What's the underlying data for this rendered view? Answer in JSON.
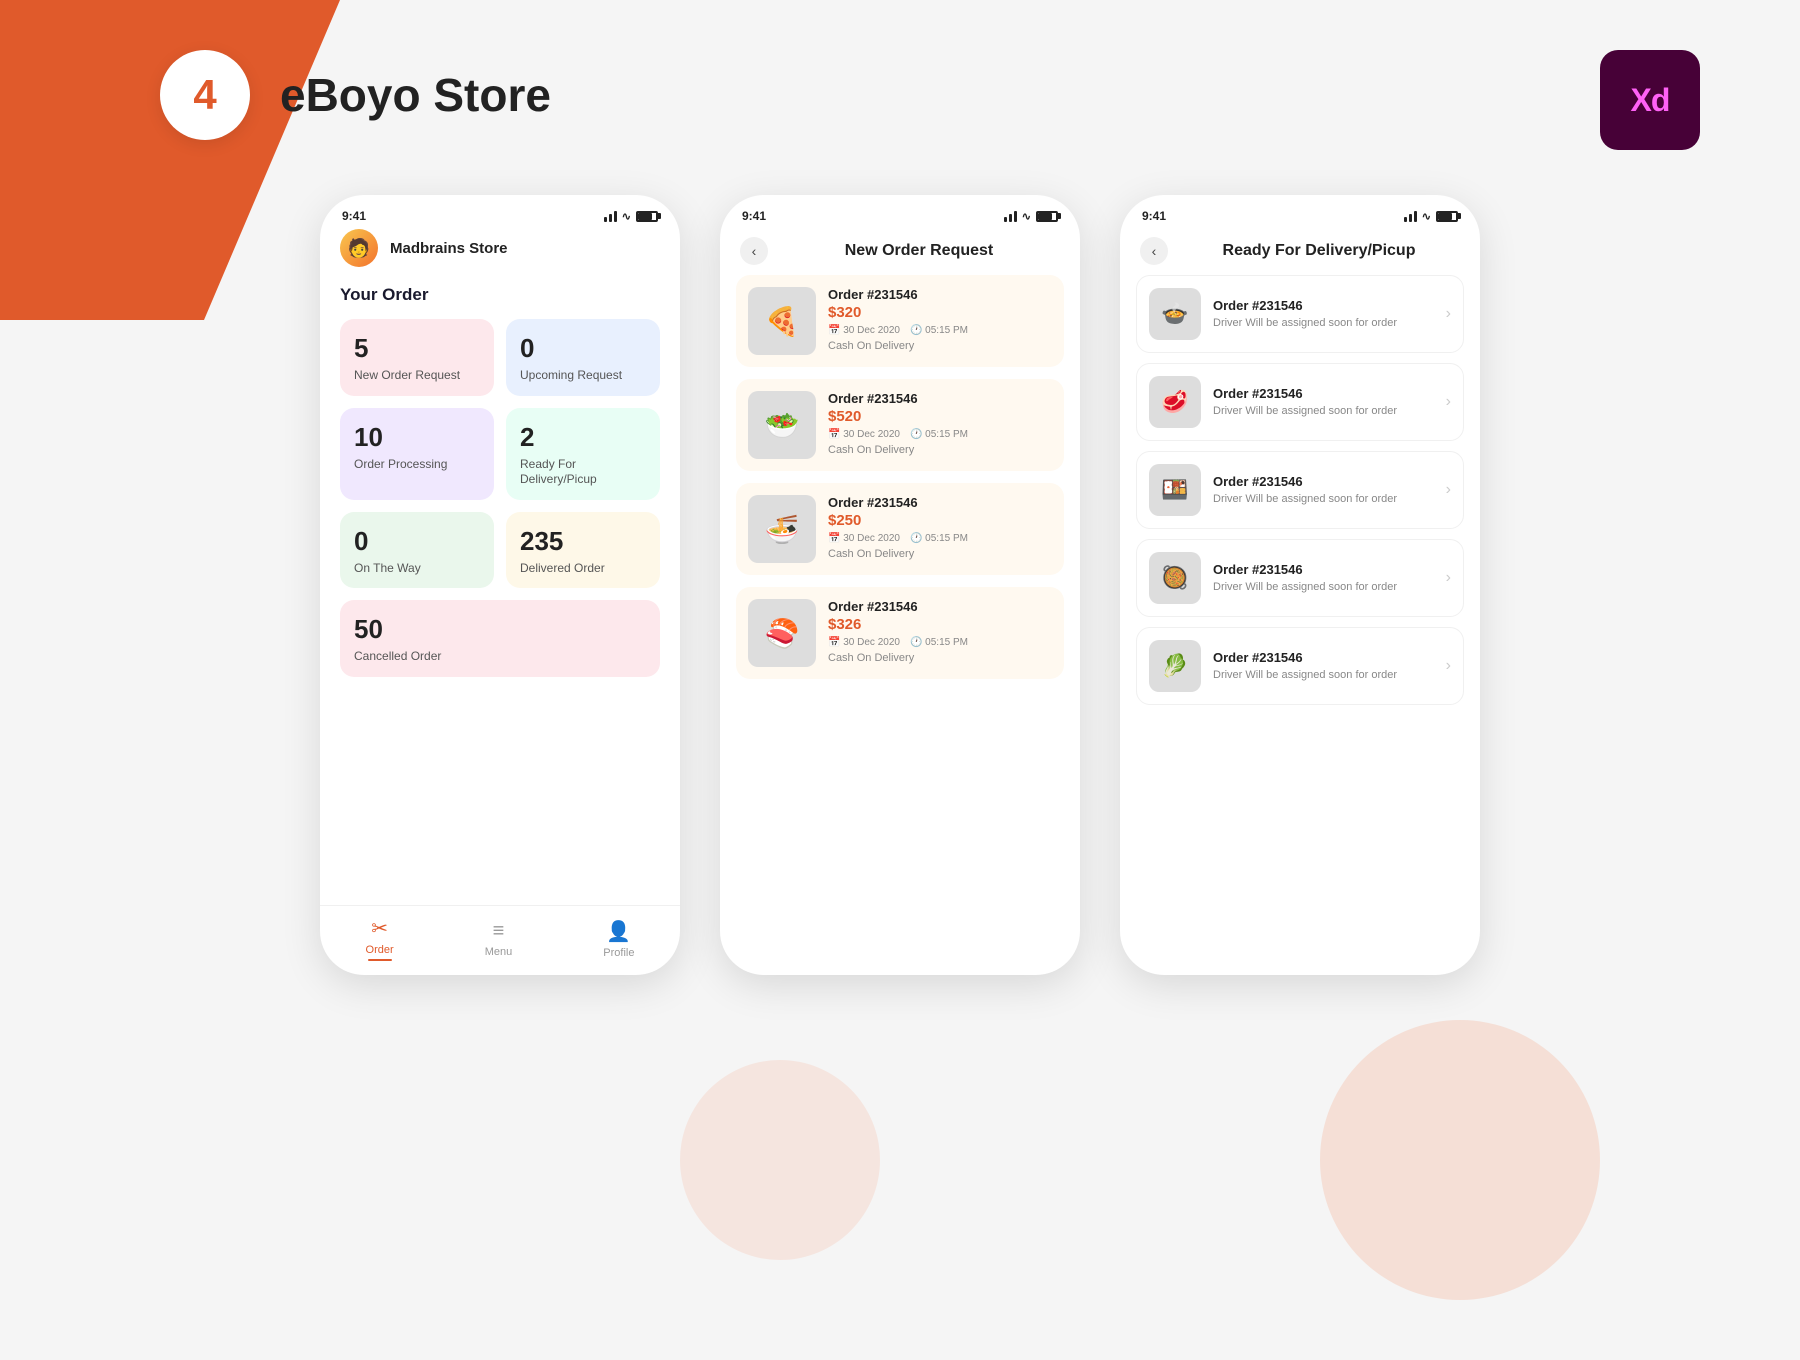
{
  "header": {
    "number": "4",
    "title": "eBoyo Store",
    "xd_label": "Xd"
  },
  "phone1": {
    "status_time": "9:41",
    "store_name": "Madbrains Store",
    "section_title": "Your Order",
    "order_cards": [
      {
        "number": "5",
        "label": "New Order Request",
        "color": "pink"
      },
      {
        "number": "0",
        "label": "Upcoming Request",
        "color": "blue"
      },
      {
        "number": "10",
        "label": "Order Processing",
        "color": "purple"
      },
      {
        "number": "2",
        "label": "Ready For Delivery/Picup",
        "color": "teal"
      },
      {
        "number": "0",
        "label": "On The Way",
        "color": "green"
      },
      {
        "number": "235",
        "label": "Delivered Order",
        "color": "yellow"
      },
      {
        "number": "50",
        "label": "Cancelled Order",
        "color": "pink",
        "wide": true
      }
    ],
    "nav": [
      {
        "label": "Order",
        "icon": "✂",
        "active": true
      },
      {
        "label": "Menu",
        "icon": "≡",
        "active": false
      },
      {
        "label": "Profile",
        "icon": "👤",
        "active": false
      }
    ]
  },
  "phone2": {
    "status_time": "9:41",
    "screen_title": "New Order Request",
    "orders": [
      {
        "id": "Order #231546",
        "price": "$320",
        "date": "30 Dec 2020",
        "time": "05:15 PM",
        "payment": "Cash On Delivery",
        "emoji": "🍕"
      },
      {
        "id": "Order #231546",
        "price": "$520",
        "date": "30 Dec 2020",
        "time": "05:15 PM",
        "payment": "Cash On Delivery",
        "emoji": "🥗"
      },
      {
        "id": "Order #231546",
        "price": "$250",
        "date": "30 Dec 2020",
        "time": "05:15 PM",
        "payment": "Cash On Delivery",
        "emoji": "🍜"
      },
      {
        "id": "Order #231546",
        "price": "$326",
        "date": "30 Dec 2020",
        "time": "05:15 PM",
        "payment": "Cash On Delivery",
        "emoji": "🍣"
      }
    ]
  },
  "phone3": {
    "status_time": "9:41",
    "screen_title": "Ready For Delivery/Picup",
    "deliveries": [
      {
        "id": "Order #231546",
        "sub": "Driver Will be assigned soon for order",
        "emoji": "🍲"
      },
      {
        "id": "Order #231546",
        "sub": "Driver Will be assigned soon for order",
        "emoji": "🥩"
      },
      {
        "id": "Order #231546",
        "sub": "Driver Will be assigned soon for order",
        "emoji": "🍱"
      },
      {
        "id": "Order #231546",
        "sub": "Driver Will be assigned soon for order",
        "emoji": "🥘"
      },
      {
        "id": "Order #231546",
        "sub": "Driver Will be assigned soon for order",
        "emoji": "🥬"
      }
    ]
  }
}
